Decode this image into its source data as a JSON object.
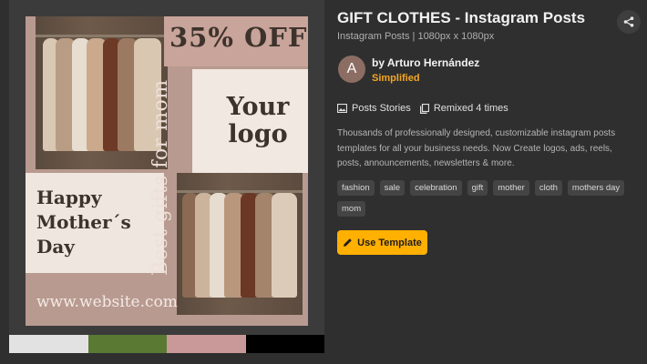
{
  "template": {
    "title": "GIFT CLOTHES - Instagram Posts",
    "subtitle": "Instagram Posts | 1080px x 1080px",
    "author_initial": "A",
    "author": "by Arturo Hernández",
    "brand": "Simplified",
    "category": "Posts Stories",
    "remixed": "Remixed 4 times",
    "description": "Thousands of professionally designed, customizable instagram posts templates for all your business needs. Now Create logos, ads, reels, posts, announcements, newsletters & more.",
    "use_button": "Use Template",
    "tags": [
      "fashion",
      "sale",
      "celebration",
      "gift",
      "mother",
      "cloth",
      "mothers day",
      "mom"
    ]
  },
  "poster": {
    "sale": "35% OFF",
    "logo_line1": "Your",
    "logo_line2": "logo",
    "vertical": "Best gifts for mom",
    "mother_line1": "Happy",
    "mother_line2": "Mother´s",
    "mother_line3": "Day",
    "website": "www.website.com"
  },
  "palette": [
    "#e2e2e2",
    "#5a7a34",
    "#c9999a",
    "#000000"
  ],
  "colors": {
    "accent": "#ffb000",
    "brand": "#f5a623"
  }
}
